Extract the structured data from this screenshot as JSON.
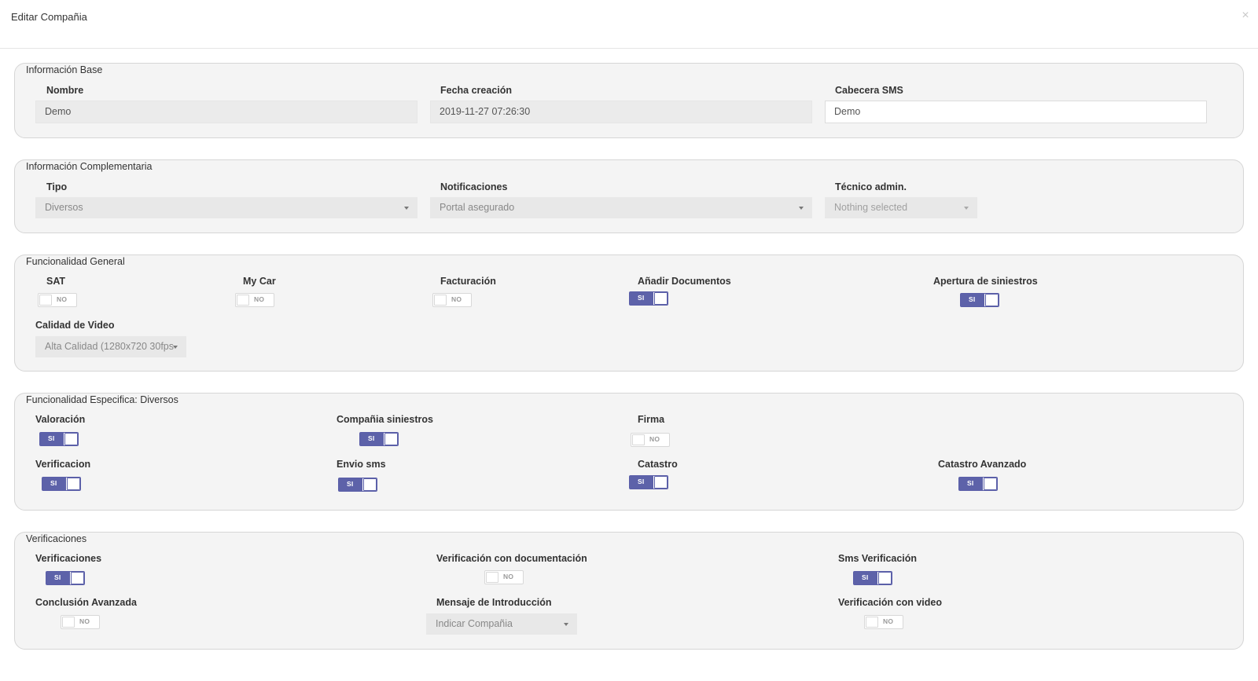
{
  "modal": {
    "title": "Editar Compañia",
    "close_symbol": "×"
  },
  "base": {
    "legend": "Información Base",
    "nombre": {
      "label": "Nombre",
      "value": "Demo"
    },
    "fecha": {
      "label": "Fecha creación",
      "value": "2019-11-27 07:26:30"
    },
    "cabecera": {
      "label": "Cabecera SMS",
      "value": "Demo"
    }
  },
  "complementaria": {
    "legend": "Información Complementaria",
    "tipo": {
      "label": "Tipo",
      "value": "Diversos"
    },
    "notificaciones": {
      "label": "Notificaciones",
      "value": "Portal asegurado"
    },
    "tecnico": {
      "label": "Técnico admin.",
      "value": "Nothing selected"
    }
  },
  "general": {
    "legend": "Funcionalidad General",
    "sat": {
      "label": "SAT",
      "state": "NO"
    },
    "mycar": {
      "label": "My Car",
      "state": "NO"
    },
    "facturacion": {
      "label": "Facturación",
      "state": "NO"
    },
    "documentos": {
      "label": "Añadir Documentos",
      "state": "SI"
    },
    "apertura": {
      "label": "Apertura de siniestros",
      "state": "SI"
    },
    "video": {
      "label": "Calidad de Video",
      "value": "Alta Calidad (1280x720 30fps"
    }
  },
  "especifica": {
    "legend": "Funcionalidad Especifica: Diversos",
    "valoracion": {
      "label": "Valoración",
      "state": "SI"
    },
    "compania": {
      "label": "Compañia siniestros",
      "state": "SI"
    },
    "firma": {
      "label": "Firma",
      "state": "NO"
    },
    "verificacion": {
      "label": "Verificacion",
      "state": "SI"
    },
    "envio": {
      "label": "Envio sms",
      "state": "SI"
    },
    "catastro": {
      "label": "Catastro",
      "state": "SI"
    },
    "catastro_av": {
      "label": "Catastro Avanzado",
      "state": "SI"
    }
  },
  "verificaciones": {
    "legend": "Verificaciones",
    "verificaciones": {
      "label": "Verificaciones",
      "state": "SI"
    },
    "documentacion": {
      "label": "Verificación con documentación",
      "state": "NO"
    },
    "sms": {
      "label": "Sms Verificación",
      "state": "SI"
    },
    "conclusion": {
      "label": "Conclusión Avanzada",
      "state": "NO"
    },
    "mensaje": {
      "label": "Mensaje de Introducción",
      "value": "Indicar Compañia"
    },
    "video": {
      "label": "Verificación con video",
      "state": "NO"
    }
  },
  "colors": {
    "toggle_on": "#5d62a9",
    "panel_bg": "#f4f4f4",
    "border": "#d6d6d6"
  }
}
